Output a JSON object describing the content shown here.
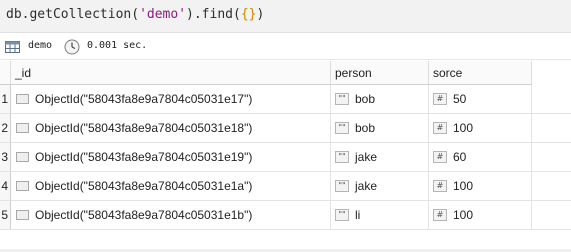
{
  "query": {
    "prefix": "db.getCollection(",
    "collection": "'demo'",
    "middle": ").find(",
    "arg": "{}",
    "suffix": ")"
  },
  "info": {
    "db_name": "demo",
    "elapsed": "0.001 sec."
  },
  "table": {
    "columns": [
      "_id",
      "person",
      "sorce"
    ],
    "rows": [
      {
        "num": "1",
        "id": "ObjectId(\"58043fa8e9a7804c05031e17\")",
        "person": "bob",
        "sorce": "50"
      },
      {
        "num": "2",
        "id": "ObjectId(\"58043fa8e9a7804c05031e18\")",
        "person": "bob",
        "sorce": "100"
      },
      {
        "num": "3",
        "id": "ObjectId(\"58043fa8e9a7804c05031e19\")",
        "person": "jake",
        "sorce": "60"
      },
      {
        "num": "4",
        "id": "ObjectId(\"58043fa8e9a7804c05031e1a\")",
        "person": "jake",
        "sorce": "100"
      },
      {
        "num": "5",
        "id": "ObjectId(\"58043fa8e9a7804c05031e1b\")",
        "person": "li",
        "sorce": "100"
      }
    ]
  },
  "icons": {
    "string_type_glyph": "\"\"",
    "number_type_glyph": "#"
  }
}
